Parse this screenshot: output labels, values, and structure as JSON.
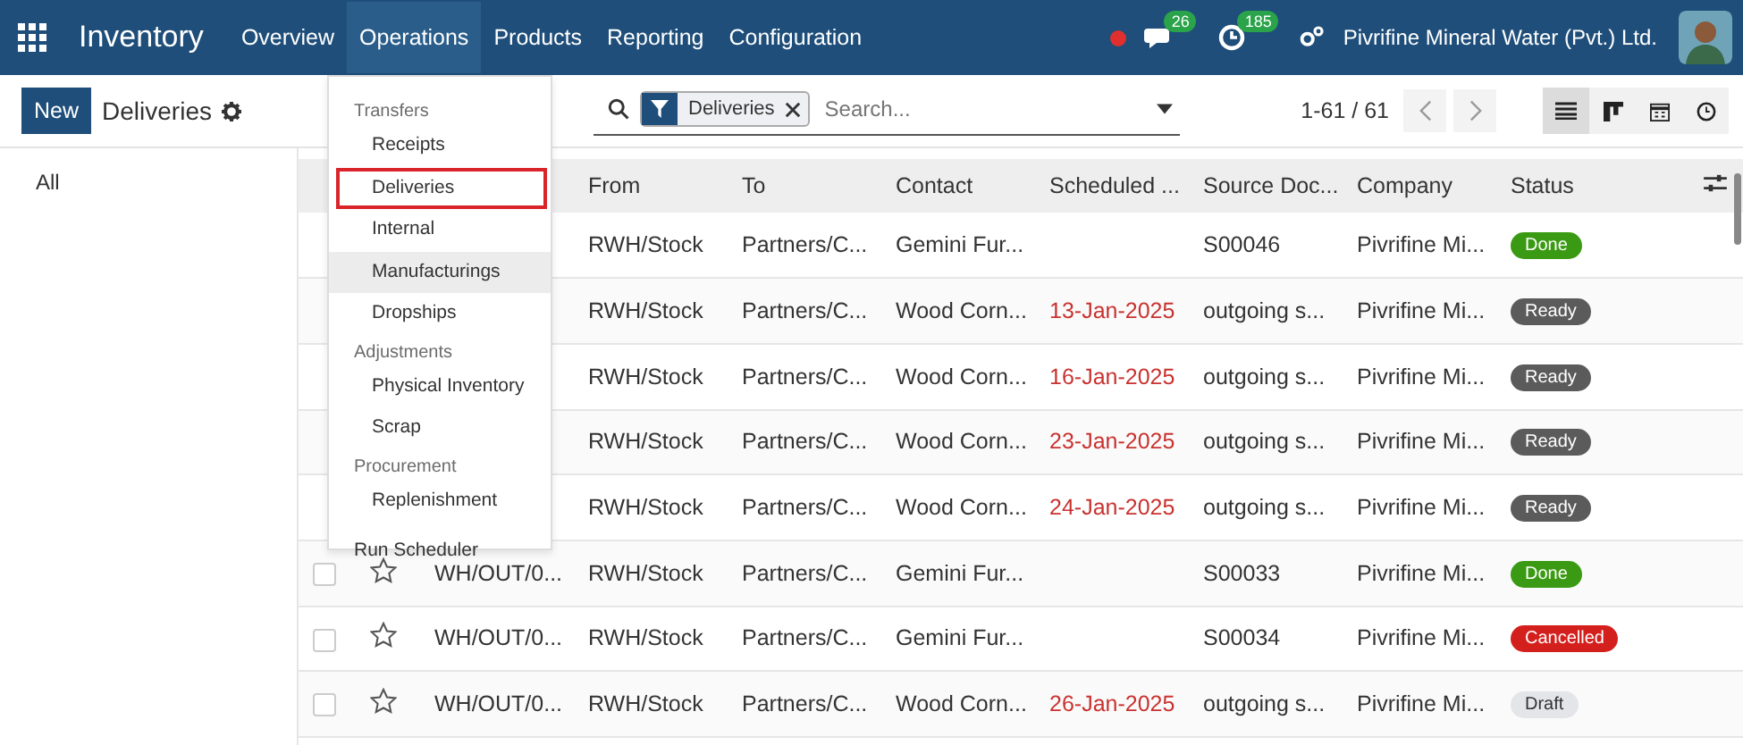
{
  "navbar": {
    "app_name": "Inventory",
    "menu": [
      {
        "label": "Overview",
        "selected": false
      },
      {
        "label": "Operations",
        "selected": true
      },
      {
        "label": "Products",
        "selected": false
      },
      {
        "label": "Reporting",
        "selected": false
      },
      {
        "label": "Configuration",
        "selected": false
      }
    ],
    "messages_count": "26",
    "activities_count": "185",
    "company": "Pivrifine Mineral Water (Pvt.) Ltd."
  },
  "control_panel": {
    "new_button": "New",
    "title": "Deliveries",
    "facet": "Deliveries",
    "search": {
      "placeholder": "Search..."
    },
    "pager": "1-61 / 61",
    "views": [
      {
        "kind": "list",
        "selected": true
      },
      {
        "kind": "kanban",
        "selected": false
      },
      {
        "kind": "calendar",
        "selected": false
      },
      {
        "kind": "activity",
        "selected": false
      }
    ]
  },
  "sidebar": {
    "items": [
      "All"
    ]
  },
  "dropdown": {
    "sections": [
      {
        "title": "Transfers",
        "items": [
          {
            "label": "Receipts",
            "hovered": false,
            "outlined": false
          },
          {
            "label": "Deliveries",
            "hovered": false,
            "outlined": true
          },
          {
            "label": "Internal",
            "hovered": false,
            "outlined": false
          },
          {
            "label": "Manufacturings",
            "hovered": true,
            "outlined": false
          },
          {
            "label": "Dropships",
            "hovered": false,
            "outlined": false
          }
        ]
      },
      {
        "title": "Adjustments",
        "items": [
          {
            "label": "Physical Inventory",
            "hovered": false,
            "outlined": false
          },
          {
            "label": "Scrap",
            "hovered": false,
            "outlined": false
          }
        ]
      },
      {
        "title": "Procurement",
        "items": [
          {
            "label": "Replenishment",
            "hovered": false,
            "outlined": false
          }
        ]
      }
    ],
    "footer": "Run Scheduler"
  },
  "table": {
    "columns": [
      "From",
      "To",
      "Contact",
      "Scheduled ...",
      "Source Doc...",
      "Company",
      "Status"
    ],
    "rows": [
      {
        "from": "RWH/Stock",
        "to": "Partners/C...",
        "contact": "Gemini Fur...",
        "source": "S00046",
        "company": "Pivrifine Mi...",
        "status": {
          "label": "Done",
          "kind": "done"
        }
      },
      {
        "from": "RWH/Stock",
        "to": "Partners/C...",
        "contact": "Wood Corn...",
        "scheduled": "13-Jan-2025",
        "late": true,
        "source": "outgoing s...",
        "company": "Pivrifine Mi...",
        "status": {
          "label": "Ready",
          "kind": "ready"
        }
      },
      {
        "from": "RWH/Stock",
        "to": "Partners/C...",
        "contact": "Wood Corn...",
        "scheduled": "16-Jan-2025",
        "late": true,
        "source": "outgoing s...",
        "company": "Pivrifine Mi...",
        "status": {
          "label": "Ready",
          "kind": "ready"
        }
      },
      {
        "from": "RWH/Stock",
        "to": "Partners/C...",
        "contact": "Wood Corn...",
        "scheduled": "23-Jan-2025",
        "late": true,
        "source": "outgoing s...",
        "company": "Pivrifine Mi...",
        "status": {
          "label": "Ready",
          "kind": "ready"
        }
      },
      {
        "from": "RWH/Stock",
        "to": "Partners/C...",
        "contact": "Wood Corn...",
        "scheduled": "24-Jan-2025",
        "late": true,
        "source": "outgoing s...",
        "company": "Pivrifine Mi...",
        "status": {
          "label": "Ready",
          "kind": "ready"
        }
      },
      {
        "reference": "WH/OUT/0...",
        "checked": false,
        "from": "RWH/Stock",
        "to": "Partners/C...",
        "contact": "Gemini Fur...",
        "source": "S00033",
        "company": "Pivrifine Mi...",
        "status": {
          "label": "Done",
          "kind": "done"
        }
      },
      {
        "reference": "WH/OUT/0...",
        "checked": false,
        "from": "RWH/Stock",
        "to": "Partners/C...",
        "contact": "Gemini Fur...",
        "source": "S00034",
        "company": "Pivrifine Mi...",
        "status": {
          "label": "Cancelled",
          "kind": "cancelled"
        }
      },
      {
        "reference": "WH/OUT/0...",
        "checked": false,
        "from": "RWH/Stock",
        "to": "Partners/C...",
        "contact": "Wood Corn...",
        "scheduled": "26-Jan-2025",
        "late": true,
        "source": "outgoing s...",
        "company": "Pivrifine Mi...",
        "status": {
          "label": "Draft",
          "kind": "draft"
        }
      }
    ]
  }
}
